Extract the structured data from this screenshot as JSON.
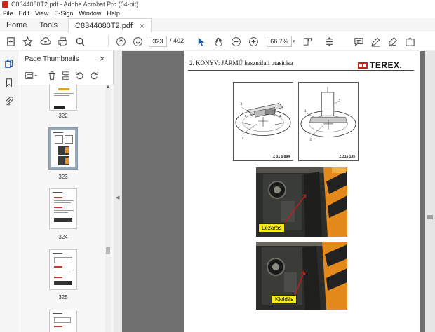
{
  "window": {
    "title": "C8344080T2.pdf - Adobe Acrobat Pro (64-bit)"
  },
  "menu": [
    "File",
    "Edit",
    "View",
    "E-Sign",
    "Window",
    "Help"
  ],
  "tabs": {
    "home": "Home",
    "tools": "Tools",
    "document": "C8344080T2.pdf",
    "close_glyph": "×"
  },
  "toolbar": {
    "page_current": "323",
    "page_total": "/ 402",
    "zoom": "66.7%",
    "zoom_dropdown": "▾",
    "icons": [
      "create-icon",
      "star-icon",
      "upload-icon",
      "print-icon",
      "search-icon",
      "page-up-icon",
      "page-down-icon",
      "select-cursor-icon",
      "hand-icon",
      "zoom-out-icon",
      "zoom-in-icon",
      "marquee-icon",
      "scroll-mode-icon",
      "measure-icon",
      "comment-icon",
      "highlight-icon",
      "sign-icon",
      "share-icon"
    ]
  },
  "left_rail": {
    "icons": [
      "copy-icon",
      "bookmark-icon",
      "attachment-icon"
    ]
  },
  "thumbnails_panel": {
    "title": "Page Thumbnails",
    "close_glyph": "×",
    "tools": [
      "options-icon",
      "delete-icon",
      "extract-icon",
      "rotate-ccw-icon",
      "rotate-cw-icon"
    ],
    "pages": [
      {
        "label": "322"
      },
      {
        "label": "323",
        "selected": true
      },
      {
        "label": "324"
      },
      {
        "label": "325"
      }
    ]
  },
  "document": {
    "header": "2. KÖNYV: JÁRMŰ használati utasítása",
    "logo": "TEREX.",
    "figures": [
      {
        "code": "Z 31 5 894",
        "callouts": [
          "1",
          "2",
          "3",
          "4"
        ]
      },
      {
        "code": "Z 315 135",
        "callouts": [
          "1",
          "2",
          "4"
        ]
      }
    ],
    "photos": [
      {
        "label": "Lezárás"
      },
      {
        "label": "Kioldás"
      }
    ]
  },
  "colors": {
    "accent_red": "#d4241c",
    "label_yellow": "#f5ea14",
    "doc_bg": "#6f6f6f"
  }
}
